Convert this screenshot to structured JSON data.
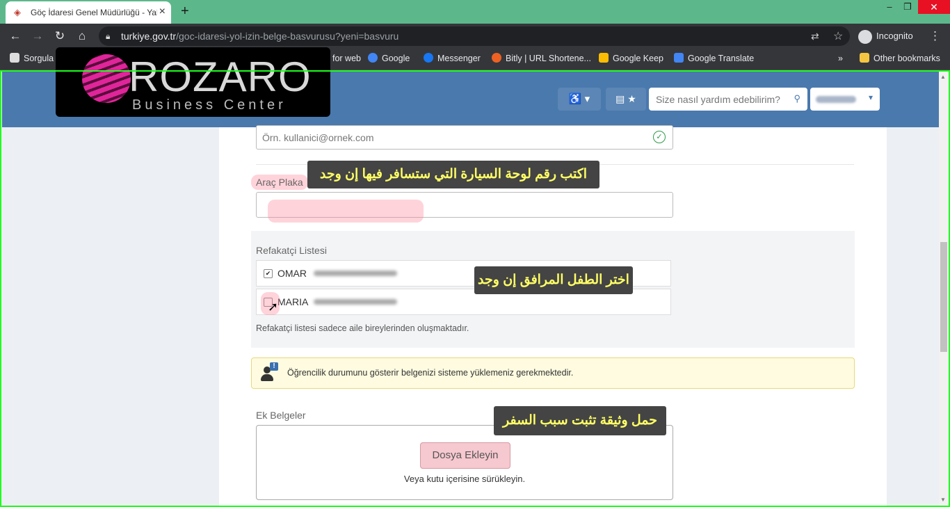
{
  "browser": {
    "tab_title": "Göç İdaresi Genel Müdürlüğü - Yabancılar",
    "tab_close": "×",
    "new_tab": "+",
    "window_controls": {
      "minimize": "–",
      "restore": "❐",
      "close": "✕"
    },
    "nav": {
      "back": "←",
      "forward": "→",
      "reload": "↻",
      "home": "⌂"
    },
    "url_host": "turkiye.gov.tr",
    "url_path": "/goc-idaresi-yol-izin-belge-basvurusu?yeni=basvuru",
    "incognito_label": "Incognito",
    "menu": "⋮",
    "bookmarks": [
      {
        "label": "Sorgula",
        "icon": "page-icon",
        "color": "#dddddd"
      },
      {
        "label": "for web",
        "icon": "app-icon",
        "color": "#5cb88b"
      },
      {
        "label": "Google",
        "icon": "google-icon",
        "color": "#4285f4"
      },
      {
        "label": "Messenger",
        "icon": "messenger-icon",
        "color": "#1877f2"
      },
      {
        "label": "Bitly | URL Shortene...",
        "icon": "bitly-icon",
        "color": "#ee6123"
      },
      {
        "label": "Google Keep",
        "icon": "keep-icon",
        "color": "#fbbc04"
      },
      {
        "label": "Google Translate",
        "icon": "translate-icon",
        "color": "#4285f4"
      }
    ],
    "bookmarks_overflow": "»",
    "other_bookmarks": "Other bookmarks"
  },
  "logo": {
    "word": "ROZARO",
    "sub": "Business Center"
  },
  "header": {
    "accessibility": "♿ ▾",
    "card": "▤ ★",
    "search_placeholder": "Size nasıl yardım edebilirim?",
    "search_icon": "⚲",
    "lang_caret": "▾"
  },
  "form": {
    "email_placeholder": "Örn. kullanici@ornek.com",
    "email_check": "✓",
    "plate_label": "Araç Plaka",
    "companion_label": "Refakatçi Listesi",
    "companions": [
      {
        "name": "OMAR",
        "checked": "✔"
      },
      {
        "name": "MARIA",
        "checked": ""
      }
    ],
    "companion_note": "Refakatçi listesi sadece aile bireylerinden oluşmaktadır.",
    "notice": "Öğrencilik durumunu gösterir belgenizi sisteme yüklemeniz gerekmektedir.",
    "notice_icon_mark": "!",
    "docs_label": "Ek Belgeler",
    "add_file": "Dosya Ekleyin",
    "drop_text": "Veya kutu içerisine sürükleyin."
  },
  "tips": {
    "plate": "اكتب رقم لوحة السيارة التي ستسافر فيها إن وجد",
    "companion": "اختر الطفل المرافق إن وجد",
    "docs": "حمل وثيقة تثبت سبب السفر"
  },
  "colors": {
    "tabbar": "#5cb88b",
    "header": "#4a79ad",
    "frame": "#1dff1d",
    "tip_text": "#ffff66"
  }
}
